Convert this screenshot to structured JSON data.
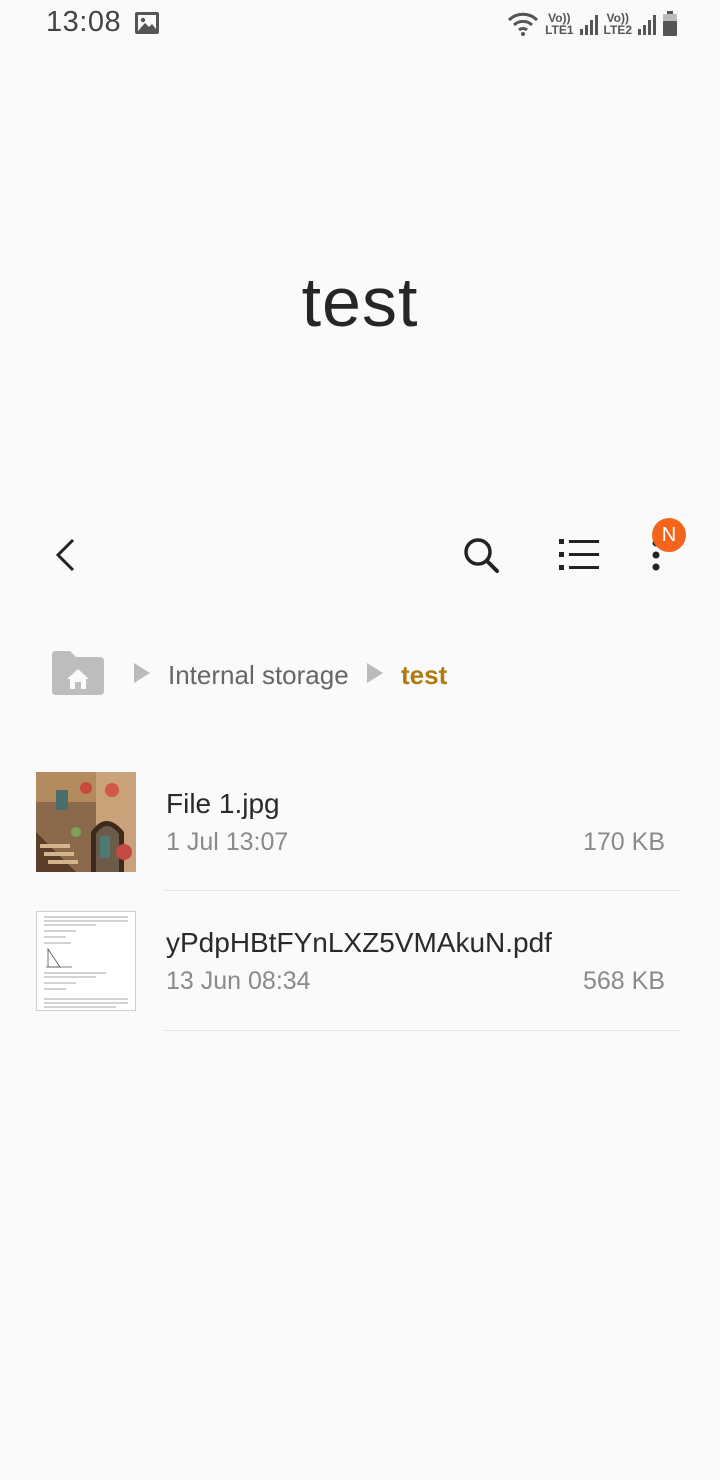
{
  "status_bar": {
    "time": "13:08",
    "sim1_top": "Vo))",
    "sim1_bottom": "LTE1",
    "sim2_top": "Vo))",
    "sim2_bottom": "LTE2"
  },
  "title": "test",
  "toolbar": {
    "back_icon": "chevron-left-icon",
    "search_icon": "search-icon",
    "list_icon": "list-view-icon",
    "more_icon": "more-vert-icon",
    "badge": "N",
    "badge_color": "#f4651b"
  },
  "breadcrumb": {
    "home_icon": "home-folder-icon",
    "items": [
      "Internal storage",
      "test"
    ],
    "current_color": "#b07a12"
  },
  "files": [
    {
      "name": "File 1.jpg",
      "date": "1 Jul 13:07",
      "size": "170 KB",
      "thumb": "photo-thumbnail"
    },
    {
      "name": "yPdpHBtFYnLXZ5VMAkuN.pdf",
      "date": "13 Jun 08:34",
      "size": "568 KB",
      "thumb": "pdf-thumbnail"
    }
  ]
}
